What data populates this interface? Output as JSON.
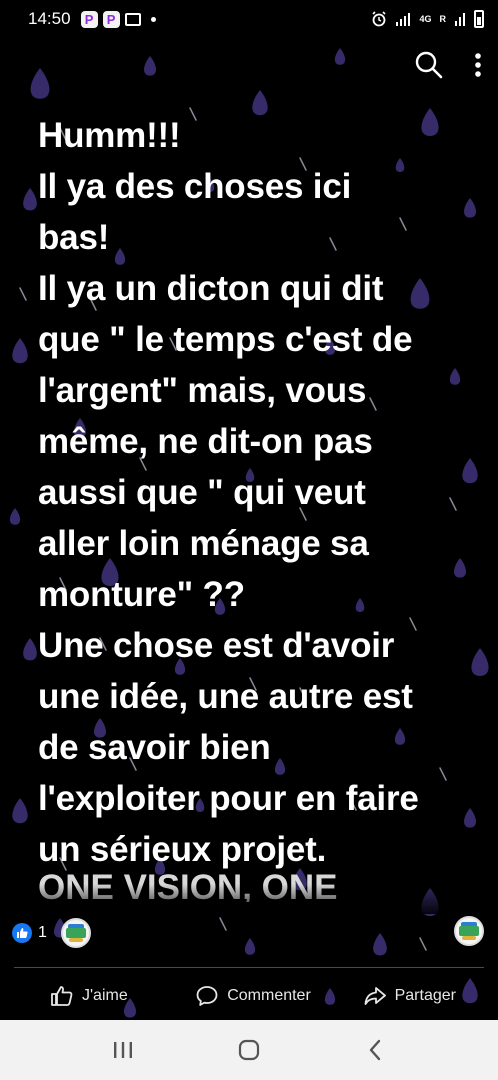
{
  "status_bar": {
    "time": "14:50",
    "app_icons": [
      "P",
      "P"
    ],
    "network_label": "4G",
    "roaming_label": "R"
  },
  "icons": {
    "search": "search-icon",
    "more": "more-vertical-icon",
    "like_badge": "thumbs-up-icon",
    "like": "thumbs-up-outline-icon",
    "comment": "comment-icon",
    "share": "share-icon",
    "recents": "recent-apps-icon",
    "home": "home-icon",
    "back": "back-icon"
  },
  "colors": {
    "background": "#000000",
    "text": "#ffffff",
    "accent": "#1877f2",
    "raindrop": "#4a3a8c"
  },
  "post": {
    "lines": [
      "Humm!!!",
      "Il ya des choses ici",
      "bas!",
      "Il ya un dicton qui dit",
      "que \" le temps c'est de",
      "l'argent\" mais, vous",
      "même, ne dit-on pas",
      "aussi que \" qui veut",
      "aller loin ménage sa",
      "monture\" ??",
      "Une chose est d'avoir",
      "une idée, une autre est",
      "de savoir bien",
      "l'exploiter pour en faire",
      "un sérieux projet."
    ],
    "truncated_line": "ONE VISION, ONE"
  },
  "reactions": {
    "count": "1"
  },
  "actions": {
    "like_label": "J'aime",
    "comment_label": "Commenter",
    "share_label": "Partager"
  }
}
